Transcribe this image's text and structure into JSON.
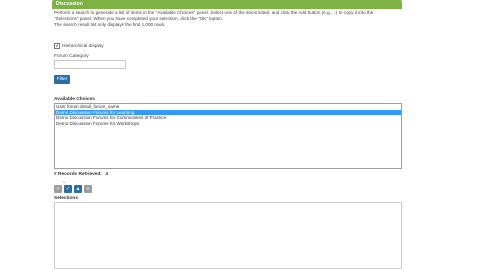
{
  "header": {
    "title": "Discussion"
  },
  "instructions": [
    "Perform a search to generate a list of items in the \"Available Choices\" panel. Select one of the items listed, and click the Add button (e.g., ↓) to copy it into the",
    "\"Selections\" panel. When you have completed your selection, click the \"OK\" button.",
    "The search result list only displays the first 1,000 rows."
  ],
  "hierarchical": {
    "label": "Hierarchical display",
    "checked": true,
    "mark": "✔"
  },
  "forum_category": {
    "label": "Forum Category",
    "value": "",
    "placeholder": ""
  },
  "filter_button": {
    "label": "Filter"
  },
  "available_choices": {
    "label": "Available Choices",
    "items": [
      {
        "text": "User forum detail_forum_name",
        "selected": false
      },
      {
        "text": "Demo Discussion Forums for Learning",
        "selected": true
      },
      {
        "text": "Demo Discussion Forums for Communities of Practice",
        "selected": false
      },
      {
        "text": "Demo Discussion Forums for Workshops",
        "selected": false
      }
    ]
  },
  "records": {
    "label": "# Records Retrieved:",
    "count": "4"
  },
  "caret": "^",
  "movers": {
    "remove_all": "»",
    "add": "✓",
    "remove": "▲",
    "add_all": "«"
  },
  "selections": {
    "label": "Selections"
  },
  "colors": {
    "header": "#7cb342",
    "button": "#2e6ea6",
    "selected": "#3399ff"
  }
}
